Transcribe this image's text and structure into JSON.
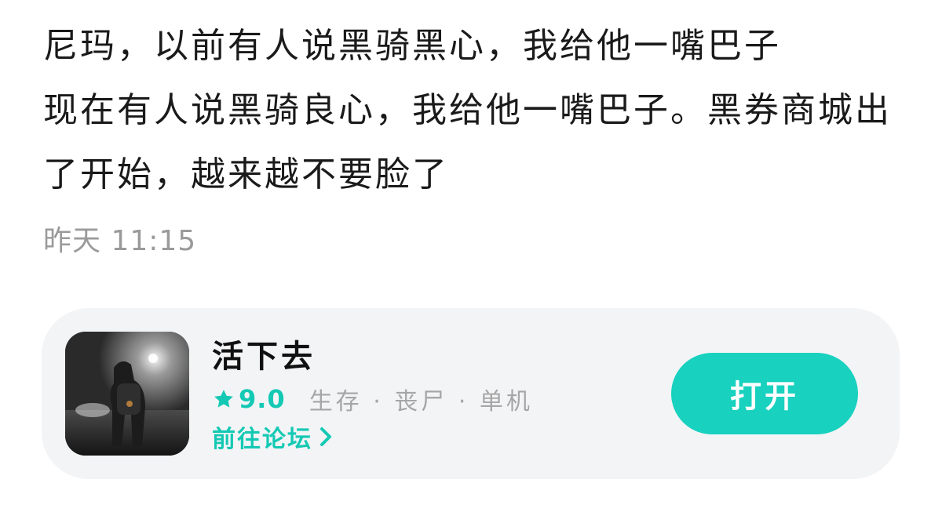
{
  "post": {
    "text": "尼玛，以前有人说黑骑黑心，我给他一嘴巴子\n现在有人说黑骑良心，我给他一嘴巴子。黑券商城出了开始，越来越不要脸了",
    "time": "昨天 11:15"
  },
  "game_card": {
    "thumbnail_icon": "game-cover-survivor-image",
    "name": "活下去",
    "rating": "9.0",
    "tags": "生存 · 丧尸 · 单机",
    "forum_link": "前往论坛",
    "open_button": "打开",
    "accent_color": "#18d1bf"
  }
}
